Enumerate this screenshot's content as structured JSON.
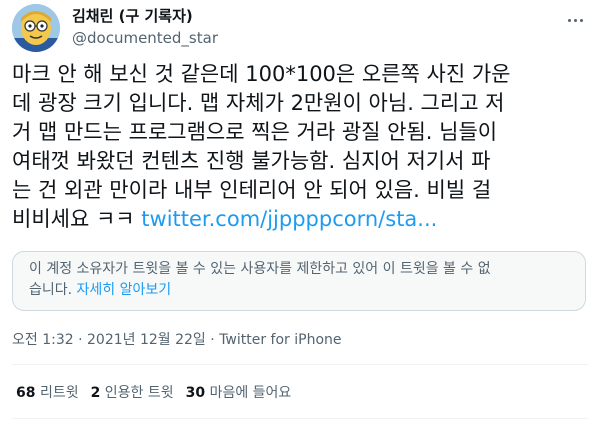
{
  "author": {
    "display_name": "김채린 (구 기록자)",
    "handle": "@documented_star"
  },
  "tweet": {
    "lines": [
      "마크 안 해 보신 것 같은데 100*100은 오른쪽 사진 가운",
      "데 광장 크기 입니다. 맵 자체가 2만원이 아님. 그리고 저",
      "거 맵 만드는 프로그램으로 찍은 거라 광질 안됨. 님들이",
      "여태껏 봐왔던 컨텐츠 진행 불가능함. 심지어 저기서 파",
      "는 건 외관 만이라 내부 인테리어 안 되어 있음. 비빌 걸"
    ],
    "last_line_text": "비비세요 ㅋㅋ ",
    "link": "twitter.com/jjppppcorn/sta..."
  },
  "notice": {
    "text": "이 계정 소유자가 트윗을 볼 수 있는 사용자를 제한하고 있어 이 트윗을 볼 수 없",
    "text_line2": "습니다. ",
    "learn_more": "자세히 알아보기"
  },
  "meta": {
    "time": "오전 1:32",
    "date": "2021년 12월 22일",
    "source": "Twitter for iPhone"
  },
  "stats": [
    {
      "count": "68",
      "label": "리트윗"
    },
    {
      "count": "2",
      "label": "인용한 트윗"
    },
    {
      "count": "30",
      "label": "마음에 들어요"
    }
  ],
  "icons": {
    "more": "more-horizontal-icon",
    "avatar": "cartoon-character-avatar"
  },
  "colors": {
    "link": "#1d9bf0",
    "secondary_text": "#536471",
    "notice_bg": "#f7f9f9"
  }
}
